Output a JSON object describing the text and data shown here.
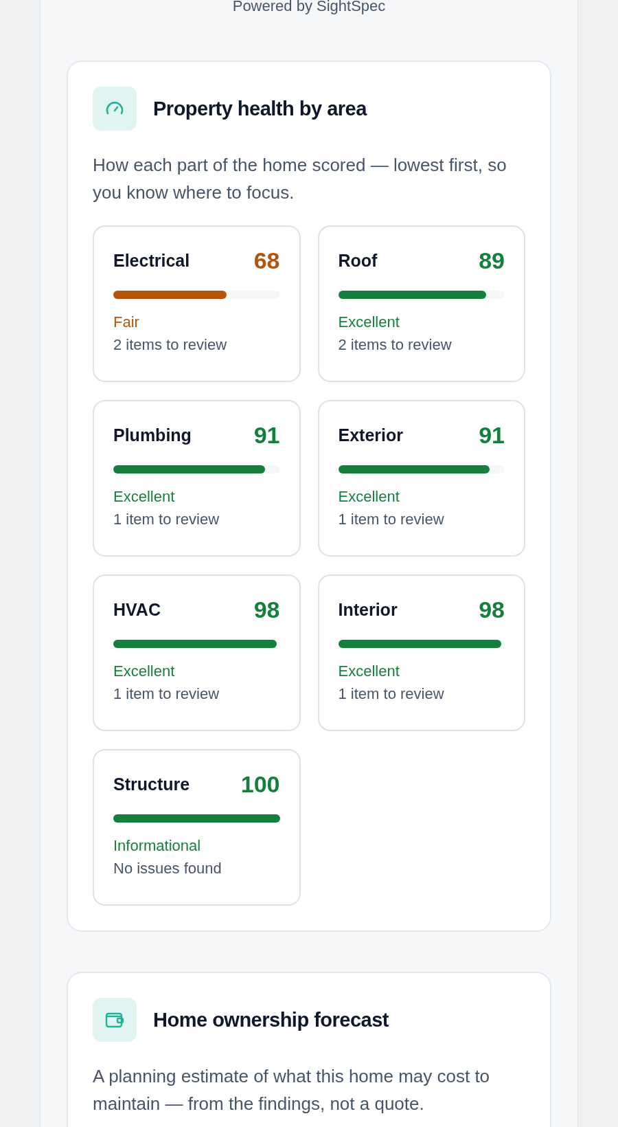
{
  "powered_by": "Powered by SightSpec",
  "health": {
    "title": "Property health by area",
    "description": "How each part of the home scored — lowest first, so you know where to focus.",
    "areas": [
      {
        "name": "Electrical",
        "score": "68",
        "level": 0.68,
        "rating": "Fair",
        "color": "#b45309",
        "review": "2 items to review"
      },
      {
        "name": "Roof",
        "score": "89",
        "level": 0.89,
        "rating": "Excellent",
        "color": "#15803d",
        "review": "2 items to review"
      },
      {
        "name": "Plumbing",
        "score": "91",
        "level": 0.91,
        "rating": "Excellent",
        "color": "#15803d",
        "review": "1 item to review"
      },
      {
        "name": "Exterior",
        "score": "91",
        "level": 0.91,
        "rating": "Excellent",
        "color": "#15803d",
        "review": "1 item to review"
      },
      {
        "name": "HVAC",
        "score": "98",
        "level": 0.98,
        "rating": "Excellent",
        "color": "#15803d",
        "review": "1 item to review"
      },
      {
        "name": "Interior",
        "score": "98",
        "level": 0.98,
        "rating": "Excellent",
        "color": "#15803d",
        "review": "1 item to review"
      },
      {
        "name": "Structure",
        "score": "100",
        "level": 1,
        "rating": "Informational",
        "color": "#15803d",
        "review": "No issues found"
      }
    ]
  },
  "forecast": {
    "title": "Home ownership forecast",
    "description": "A planning estimate of what this home may cost to maintain — from the findings, not a quote."
  }
}
